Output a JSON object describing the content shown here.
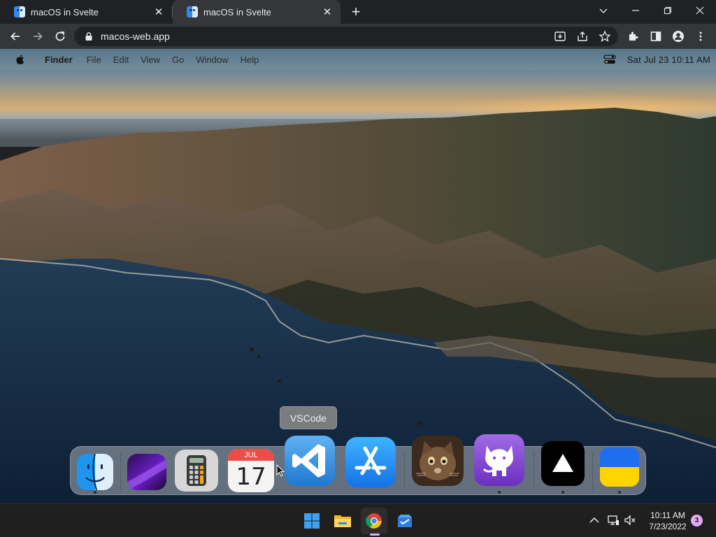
{
  "browser": {
    "tabs": [
      {
        "title": "macOS in Svelte"
      },
      {
        "title": "macOS in Svelte"
      }
    ],
    "url": "macos-web.app"
  },
  "menubar": {
    "app_name": "Finder",
    "items": [
      "File",
      "Edit",
      "View",
      "Go",
      "Window",
      "Help"
    ],
    "clock": "Sat Jul 23  10:11 AM"
  },
  "tooltip": {
    "label": "VSCode"
  },
  "dock": {
    "calendar_month": "JUL",
    "calendar_day": "17",
    "apps": [
      {
        "icon": "finder-icon",
        "running": true
      },
      {
        "icon": "purple-wallpaper-icon",
        "running": false
      },
      {
        "icon": "calculator-icon",
        "running": false
      },
      {
        "icon": "calendar-icon",
        "running": false
      },
      {
        "icon": "vscode-icon",
        "running": false
      },
      {
        "icon": "app-store-icon",
        "running": false
      },
      {
        "icon": "cat-photo-icon",
        "running": false
      },
      {
        "icon": "github-icon",
        "running": true
      },
      {
        "icon": "vercel-icon",
        "running": true
      },
      {
        "icon": "ukraine-flag-icon",
        "running": true
      }
    ]
  },
  "taskbar": {
    "apps": [
      "windows-start-icon",
      "file-explorer-icon",
      "chrome-icon",
      "store-icon"
    ],
    "time": "10:11 AM",
    "date": "7/23/2022",
    "notifications": "3"
  },
  "colors": {
    "chrome_dark": "#202124",
    "chrome_toolbar": "#35363a",
    "taskbar": "#1f1f1f",
    "vscode_blue": "#2f8ee6",
    "appstore_blue": "#1a8cf6",
    "github_purple": "#8a4fd6"
  }
}
